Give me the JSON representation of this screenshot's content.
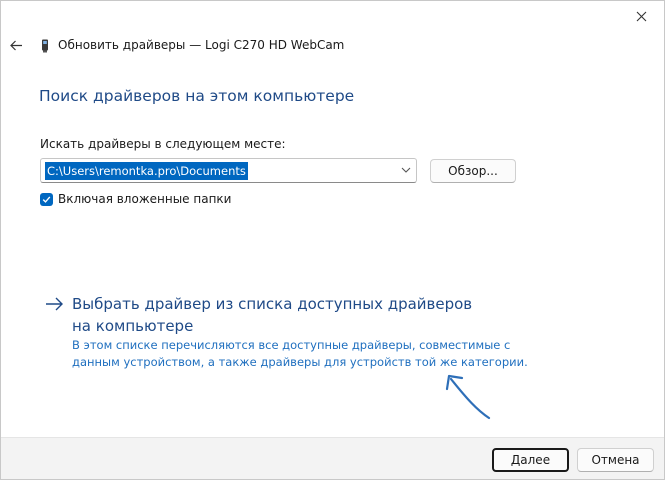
{
  "window": {
    "title": "Обновить драйверы — Logi C270 HD WebCam",
    "close_icon": "close-icon",
    "back_icon": "back-arrow-icon",
    "device_icon": "webcam-device-icon"
  },
  "main": {
    "heading": "Поиск драйверов на этом компьютере",
    "path_label": "Искать драйверы в следующем месте:",
    "path_value": "C:\\Users\\remontka.pro\\Documents",
    "browse_label": "Обзор...",
    "include_subfolders_label": "Включая вложенные папки",
    "include_subfolders_checked": true,
    "pick_link_title": "Выбрать драйвер из списка доступных драйверов на компьютере",
    "pick_link_description": "В этом списке перечисляются все доступные драйверы, совместимые с данным устройством, а также драйверы для устройств той же категории."
  },
  "footer": {
    "next_label": "Далее",
    "cancel_label": "Отмена"
  },
  "colors": {
    "accent": "#0067c0",
    "heading": "#1f4a87",
    "link_description": "#1f6fbf",
    "annotation": "#2e6fb8",
    "footer_bg": "#f3f3f3"
  }
}
